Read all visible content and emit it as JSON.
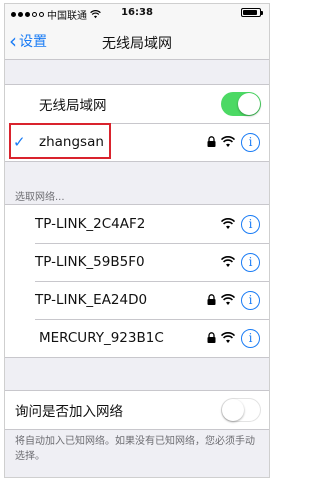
{
  "status_bar": {
    "carrier": "中国联通",
    "time": "16:38",
    "signal_filled": 3,
    "signal_total": 5,
    "battery_level": 0.9
  },
  "nav": {
    "back_label": "设置",
    "title": "无线局域网"
  },
  "wlan": {
    "label": "无线局域网",
    "enabled": true,
    "connected_network": "zhangsan",
    "connected_secured": true
  },
  "choose_network": {
    "header": "选取网络...",
    "networks": [
      {
        "name": "TP-LINK_2C4AF2",
        "secured": false
      },
      {
        "name": "TP-LINK_59B5F0",
        "secured": false
      },
      {
        "name": "TP-LINK_EA24D0",
        "secured": true
      },
      {
        "name": "MERCURY_923B1C",
        "secured": true
      }
    ]
  },
  "ask_to_join": {
    "label": "询问是否加入网络",
    "enabled": false,
    "note": "将自动加入已知网络。如果没有已知网络，您必须手动选择。"
  },
  "colors": {
    "accent": "#1a7cf5",
    "toggle_on": "#4cd964",
    "highlight": "#d9232d"
  },
  "icons": {
    "info": "i",
    "check": "✓"
  }
}
